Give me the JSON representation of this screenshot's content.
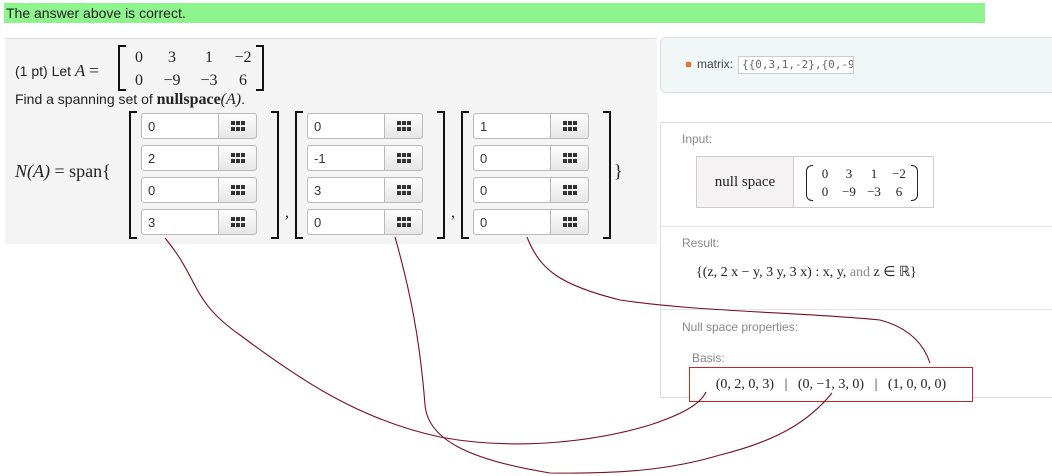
{
  "banner": {
    "text": "The answer above is correct.",
    "color": "#8ef58e"
  },
  "problem": {
    "points": "(1 pt) Let",
    "var": "A",
    "eq": "=",
    "matrix": [
      [
        "0",
        "3",
        "1",
        "−2"
      ],
      [
        "0",
        "−9",
        "−3",
        "6"
      ]
    ],
    "find_prefix": "Find a spanning set of",
    "find_math": "nullspace",
    "find_arg": "(A)",
    "find_suffix": ".",
    "span_left": "N(A)",
    "span_right": "= span{",
    "close_brace": "}",
    "comma": ",",
    "vectors": [
      [
        "0",
        "2",
        "0",
        "3"
      ],
      [
        "0",
        "-1",
        "3",
        "0"
      ],
      [
        "1",
        "0",
        "0",
        "0"
      ]
    ],
    "grid_button_icon": "matrix-grid-icon"
  },
  "wolfram": {
    "input_label": "matrix:",
    "input_code": "{{0,3,1,-2},{0,-9",
    "input_pod_title": "Input:",
    "input_op": "null space",
    "input_matrix": [
      [
        "0",
        "3",
        "1",
        "−2"
      ],
      [
        "0",
        "−9",
        "−3",
        "6"
      ]
    ],
    "result_title": "Result:",
    "result_main": "{(z, 2 x − y, 3 y, 3 x) : x, y,",
    "result_and": " and ",
    "result_tail": "z ∈ ℝ}",
    "props_title": "Null space properties:",
    "basis_title": "Basis:",
    "basis_text": "(0, 2, 0, 3)   |   (0, −1, 3, 0)   |   (1, 0, 0, 0)",
    "basis_border_color": "#c0252b"
  },
  "annotation_color": "#7a1020"
}
